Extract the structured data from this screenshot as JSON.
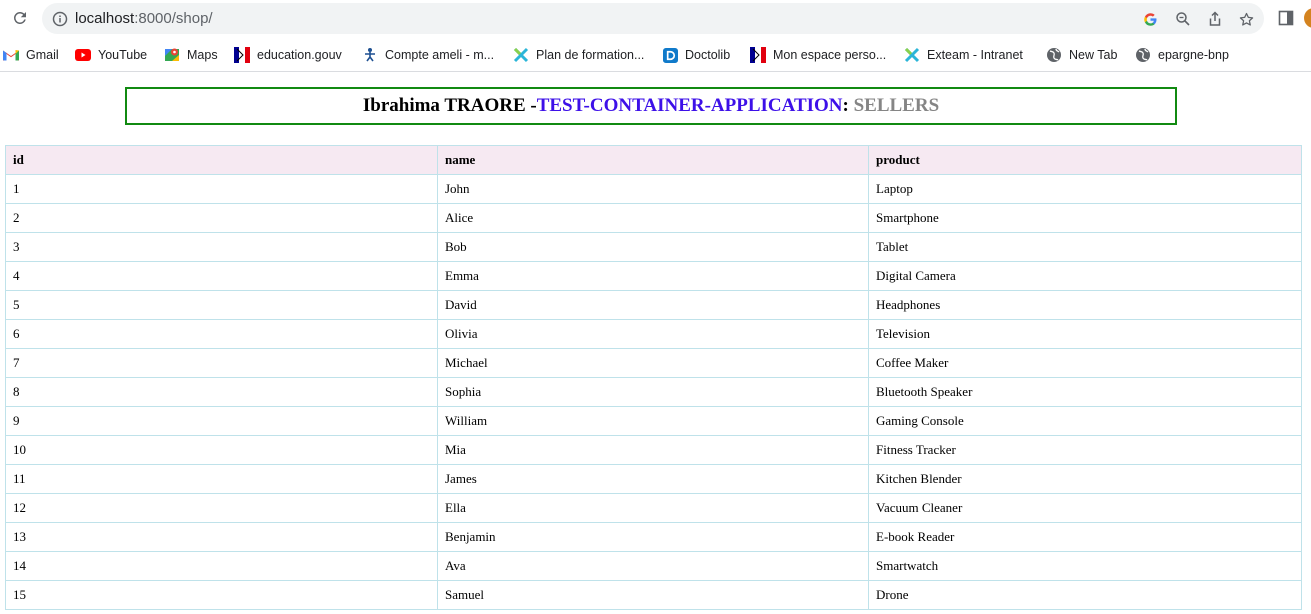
{
  "browser": {
    "url_host": "localhost",
    "url_path": ":8000/shop/",
    "bookmarks": [
      {
        "label": "Gmail",
        "icon": "gmail-icon"
      },
      {
        "label": "YouTube",
        "icon": "youtube-icon"
      },
      {
        "label": "Maps",
        "icon": "maps-icon"
      },
      {
        "label": "education.gouv",
        "icon": "marianne-icon"
      },
      {
        "label": "Compte ameli - m...",
        "icon": "ameli-icon"
      },
      {
        "label": "Plan de formation...",
        "icon": "exteam-icon"
      },
      {
        "label": "Doctolib",
        "icon": "doctolib-icon"
      },
      {
        "label": "Mon espace perso...",
        "icon": "marianne-icon"
      },
      {
        "label": "Exteam - Intranet",
        "icon": "exteam-icon"
      },
      {
        "label": "New Tab",
        "icon": "globe-icon"
      },
      {
        "label": "epargne-bnp",
        "icon": "globe-icon"
      }
    ]
  },
  "page": {
    "title_name": "Ibrahima TRAORE -",
    "title_app": "TEST-CONTAINER-APPLICATION",
    "title_sep": ": ",
    "title_section": "SELLERS",
    "colors": {
      "border": "#118a11",
      "app": "#3d10e8",
      "section": "#858585",
      "header_bg": "#f6e9f2",
      "grid": "#bfe2ea"
    }
  },
  "table": {
    "headers": [
      "id",
      "name",
      "product"
    ],
    "rows": [
      [
        "1",
        "John",
        "Laptop"
      ],
      [
        "2",
        "Alice",
        "Smartphone"
      ],
      [
        "3",
        "Bob",
        "Tablet"
      ],
      [
        "4",
        "Emma",
        "Digital Camera"
      ],
      [
        "5",
        "David",
        "Headphones"
      ],
      [
        "6",
        "Olivia",
        "Television"
      ],
      [
        "7",
        "Michael",
        "Coffee Maker"
      ],
      [
        "8",
        "Sophia",
        "Bluetooth Speaker"
      ],
      [
        "9",
        "William",
        "Gaming Console"
      ],
      [
        "10",
        "Mia",
        "Fitness Tracker"
      ],
      [
        "11",
        "James",
        "Kitchen Blender"
      ],
      [
        "12",
        "Ella",
        "Vacuum Cleaner"
      ],
      [
        "13",
        "Benjamin",
        "E-book Reader"
      ],
      [
        "14",
        "Ava",
        "Smartwatch"
      ],
      [
        "15",
        "Samuel",
        "Drone"
      ]
    ]
  }
}
